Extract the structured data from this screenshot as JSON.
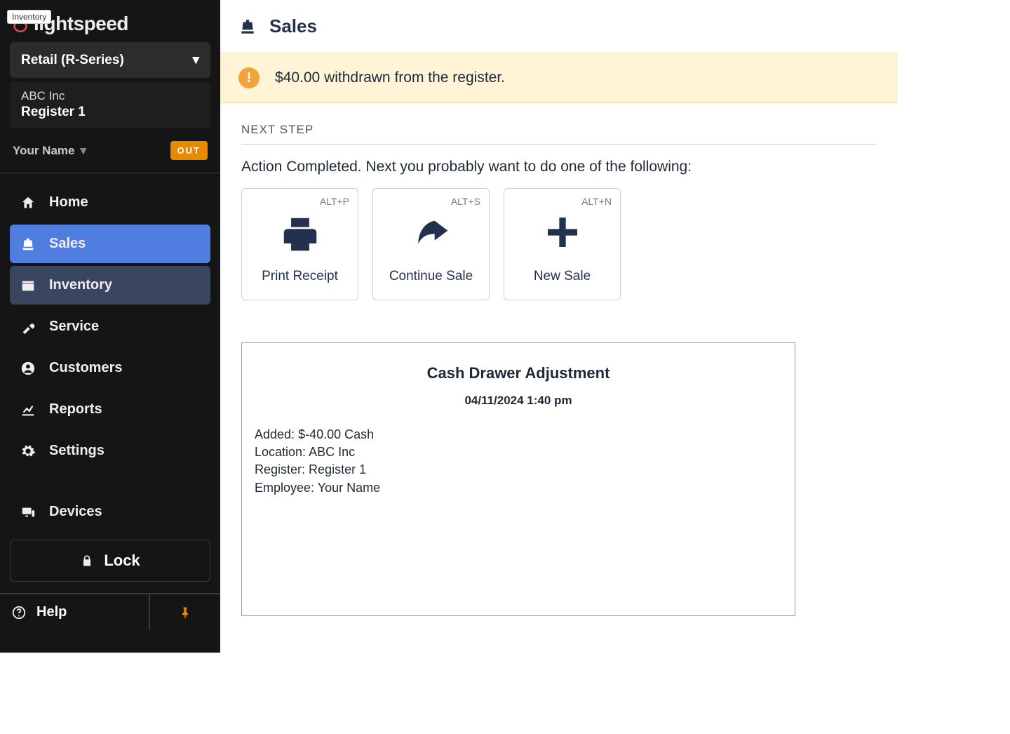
{
  "sidebar": {
    "brand": "lightspeed",
    "tooltip": "Inventory",
    "product_selector": "Retail (R-Series)",
    "company": "ABC Inc",
    "register": "Register 1",
    "user_name": "Your Name",
    "out_badge": "OUT",
    "nav": {
      "home": "Home",
      "sales": "Sales",
      "inventory": "Inventory",
      "service": "Service",
      "customers": "Customers",
      "reports": "Reports",
      "settings": "Settings",
      "devices": "Devices"
    },
    "lock": "Lock",
    "help": "Help"
  },
  "header": {
    "title": "Sales"
  },
  "banner": {
    "message": "$40.00 withdrawn from the register."
  },
  "next_step": {
    "label": "NEXT STEP",
    "instruction": "Action Completed. Next you probably want to do one of the following:",
    "actions": {
      "print": {
        "label": "Print Receipt",
        "shortcut": "ALT+P"
      },
      "continue": {
        "label": "Continue Sale",
        "shortcut": "ALT+S"
      },
      "new": {
        "label": "New Sale",
        "shortcut": "ALT+N"
      }
    }
  },
  "receipt": {
    "title": "Cash Drawer Adjustment",
    "datetime": "04/11/2024 1:40 pm",
    "lines": {
      "added_label": "Added:",
      "added_value": "$-40.00 Cash",
      "location_label": "Location:",
      "location_value": "ABC Inc",
      "register_label": "Register:",
      "register_value": "Register 1",
      "employee_label": "Employee:",
      "employee_value": "Your Name"
    }
  }
}
